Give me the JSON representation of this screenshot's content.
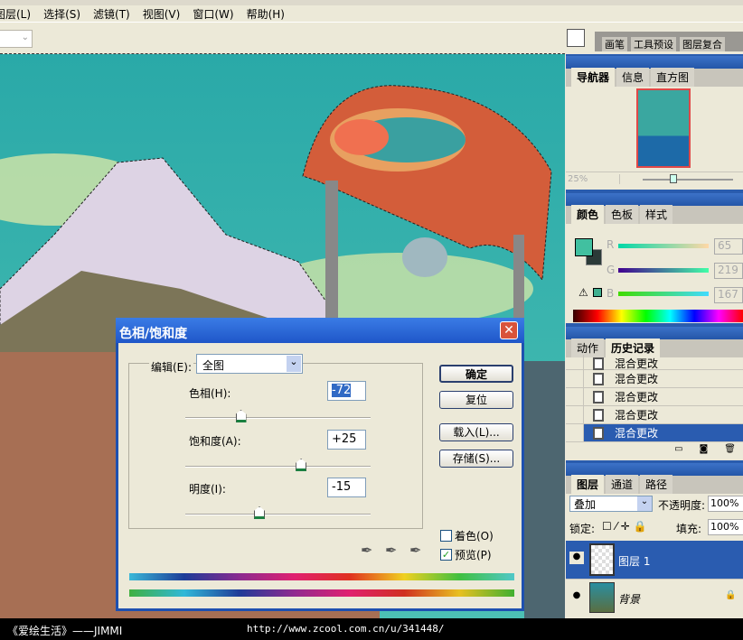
{
  "menu": [
    "图层(L)",
    "选择(S)",
    "滤镜(T)",
    "视图(V)",
    "窗口(W)",
    "帮助(H)"
  ],
  "palette_well": [
    "画笔",
    "工具预设",
    "图层复合"
  ],
  "navigator": {
    "tabs": [
      "导航器",
      "信息",
      "直方图"
    ],
    "zoom": "25%"
  },
  "color": {
    "tabs": [
      "颜色",
      "色板",
      "样式"
    ],
    "labels": [
      "R",
      "G",
      "B"
    ],
    "values": [
      "65",
      "219",
      "167"
    ],
    "fg": "#41dba7",
    "bg": "#2b3a38"
  },
  "history": {
    "tabs": [
      "动作",
      "历史记录"
    ],
    "items": [
      "混合更改",
      "混合更改",
      "混合更改",
      "混合更改",
      "混合更改"
    ]
  },
  "layers": {
    "tabs": [
      "图层",
      "通道",
      "路径"
    ],
    "blend": "叠加",
    "opacity_label": "不透明度:",
    "opacity": "100%",
    "lock_label": "锁定:",
    "fill_label": "填充:",
    "fill": "100%",
    "items": [
      "图层 1",
      "背景"
    ]
  },
  "dialog": {
    "title": "色相/饱和度",
    "edit_label": "编辑(E):",
    "edit_value": "全图",
    "hue_label": "色相(H):",
    "hue": "-72",
    "sat_label": "饱和度(A):",
    "sat": "+25",
    "light_label": "明度(I):",
    "light": "-15",
    "hue_pos": 0.3,
    "sat_pos": 0.625,
    "light_pos": 0.4,
    "ok": "确定",
    "reset": "复位",
    "load": "载入(L)...",
    "save": "存储(S)...",
    "colorize": "着色(O)",
    "preview": "预览(P)"
  },
  "footer": {
    "left": "《爱绘生活》——JIMMI",
    "url": "http://www.zcool.com.cn/u/341448/"
  }
}
